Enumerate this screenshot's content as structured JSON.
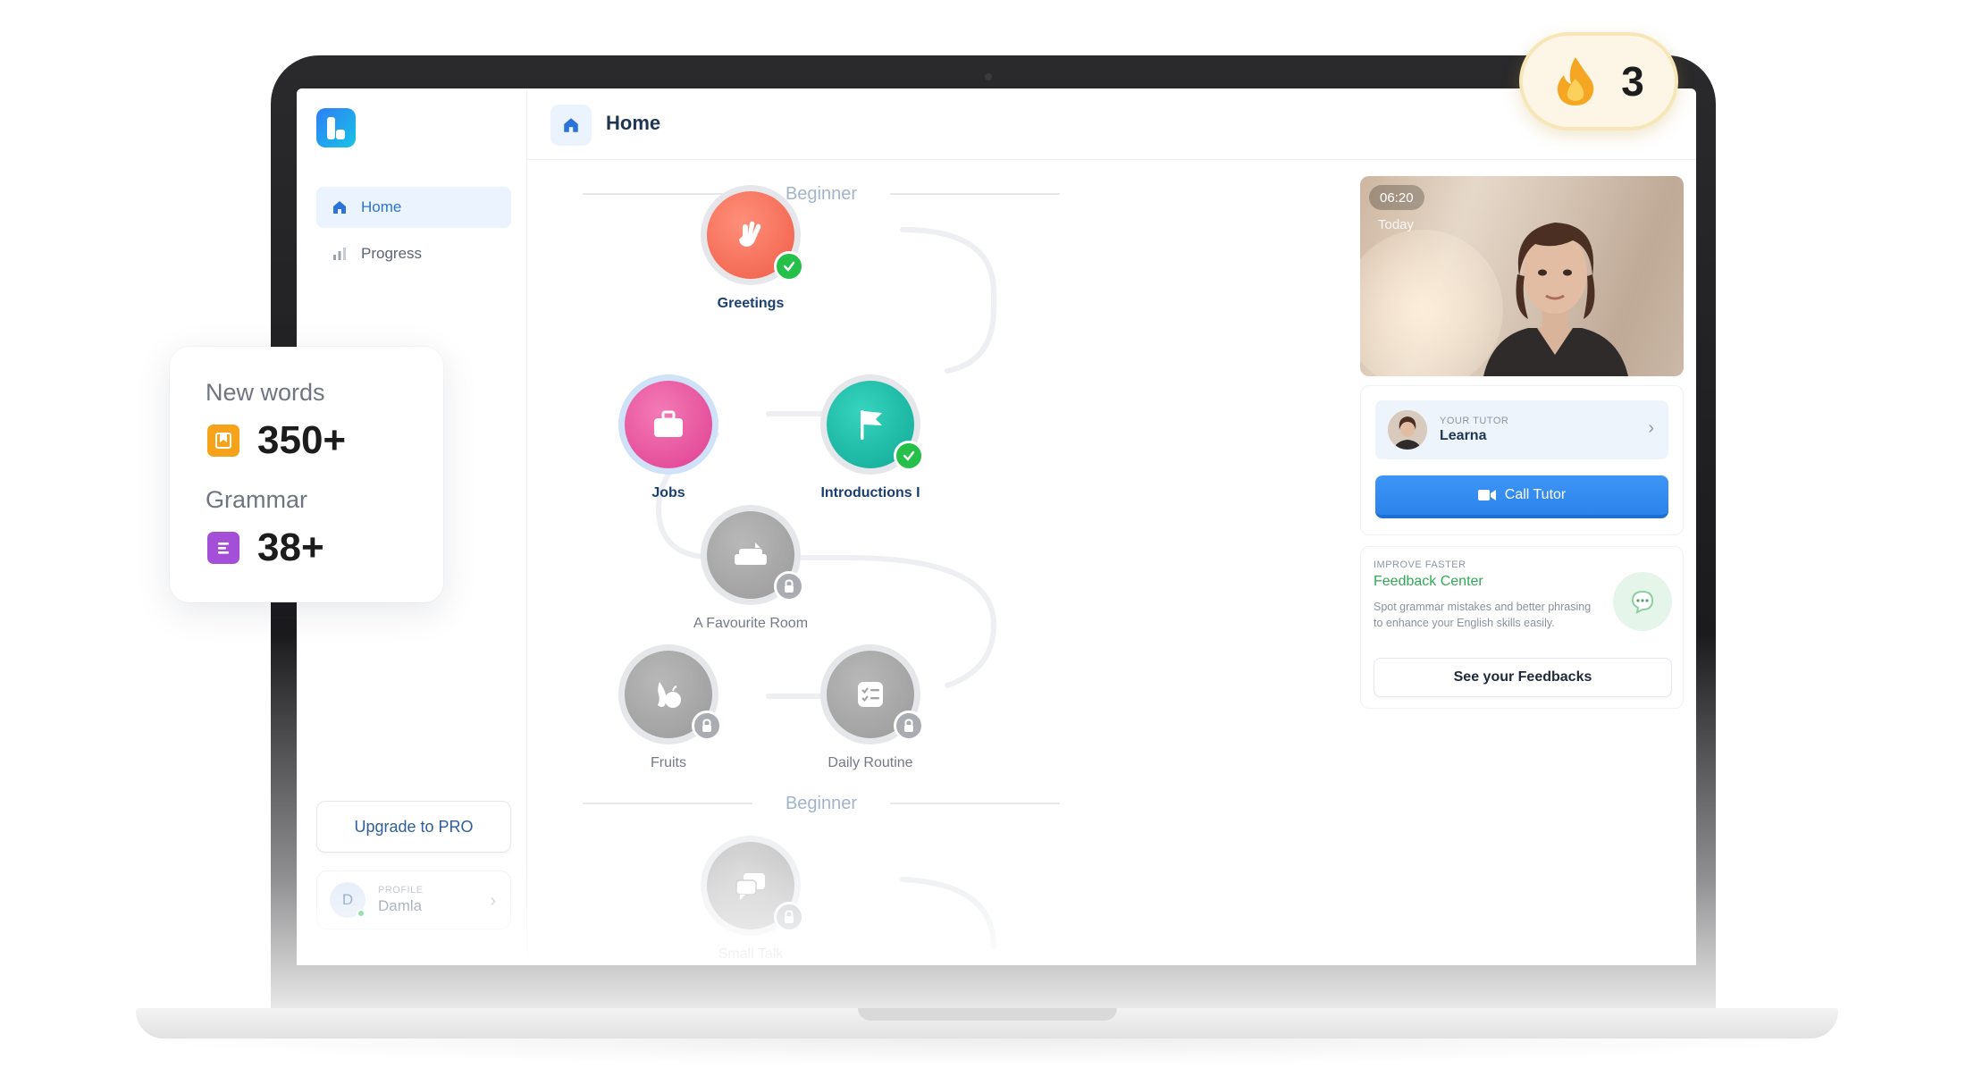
{
  "app": {
    "logo_icon": "app-logo-icon",
    "accent_color": "#2b73d8"
  },
  "sidebar": {
    "items": [
      {
        "label": "Home",
        "icon": "home-icon",
        "active": true
      },
      {
        "label": "Progress",
        "icon": "bar-chart-icon",
        "active": false
      }
    ],
    "upgrade_label": "Upgrade to PRO",
    "profile": {
      "caption": "PROFILE",
      "initial": "D",
      "name": "Damla"
    }
  },
  "header": {
    "title": "Home",
    "icon": "home-icon"
  },
  "path": {
    "sections": [
      "Beginner",
      "Beginner"
    ],
    "lessons": [
      {
        "label": "Greetings",
        "status": "completed",
        "icon": "waving-hand-icon",
        "color": "#f26f5a"
      },
      {
        "label": "Jobs",
        "status": "current",
        "icon": "briefcase-icon",
        "color": "#e8559f"
      },
      {
        "label": "Introductions I",
        "status": "completed",
        "icon": "flag-icon",
        "color": "#1bb8a6"
      },
      {
        "label": "A Favourite Room",
        "status": "locked",
        "icon": "sofa-icon",
        "color": "#a6a6a6"
      },
      {
        "label": "Fruits",
        "status": "locked",
        "icon": "fruit-icon",
        "color": "#a6a6a6"
      },
      {
        "label": "Daily Routine",
        "status": "locked",
        "icon": "checklist-icon",
        "color": "#a6a6a6"
      },
      {
        "label": "Small Talk",
        "status": "locked",
        "icon": "chat-bubbles-icon",
        "color": "#c9c9c9"
      }
    ]
  },
  "video": {
    "time": "06:20",
    "date": "Today"
  },
  "tutor": {
    "caption": "YOUR TUTOR",
    "name": "Learna",
    "call_label": "Call Tutor"
  },
  "feedback": {
    "caption": "IMPROVE FASTER",
    "title": "Feedback Center",
    "text": "Spot grammar mistakes and better phrasing to enhance your English skills easily.",
    "button_label": "See your Feedbacks",
    "icon": "chat-bubble-icon"
  },
  "streak": {
    "count": "3",
    "icon": "flame-icon"
  },
  "stats": {
    "new_words_label": "New words",
    "new_words_value": "350+",
    "grammar_label": "Grammar",
    "grammar_value": "38+"
  }
}
